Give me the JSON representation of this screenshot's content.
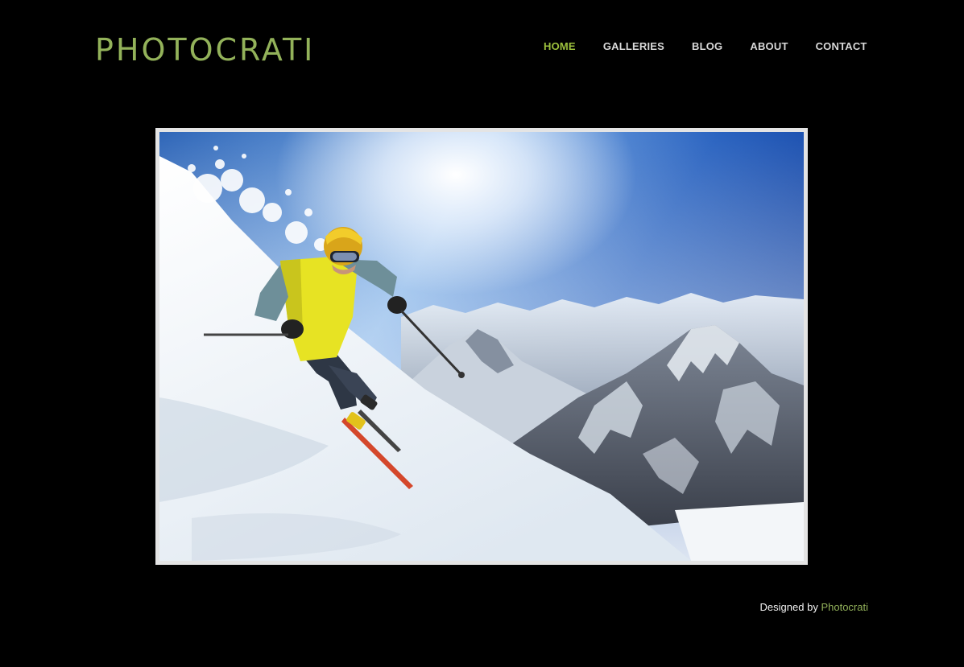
{
  "site": {
    "logo": "PHOTOCRATI"
  },
  "nav": {
    "items": [
      "HOME",
      "GALLERIES",
      "BLOG",
      "ABOUT",
      "CONTACT"
    ],
    "active_index": 0
  },
  "footer": {
    "prefix": "Designed by",
    "link": "Photocrati"
  },
  "colors": {
    "background": "#000000",
    "accent": "#9dc13d",
    "logo": "#93b25a"
  }
}
